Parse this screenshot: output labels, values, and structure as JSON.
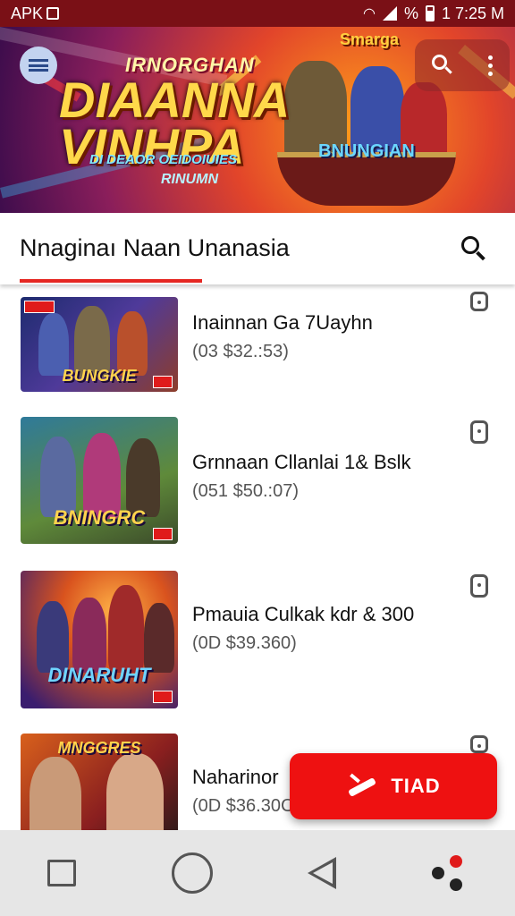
{
  "status_bar": {
    "app_label": "APK",
    "percent_label": "%",
    "time": "1 7:25 M"
  },
  "banner": {
    "top_logo": "Smarga",
    "subtitle": "IRNORGHAN",
    "title_line1": "DIAANNA",
    "title_line2": "VINHPA",
    "tagline": "DI DEAOR OEIDOIUIES",
    "small_text": "RINUMN",
    "right_title": "BNUNGIAN"
  },
  "section": {
    "title": "Nnaginaı Naan Unanasia"
  },
  "games": [
    {
      "thumb_label": "BUNGKIE",
      "title": "Inainnan Ga 7Uayhn",
      "price": "(03 $32.:53)"
    },
    {
      "thumb_label": "BNINGRC",
      "title": "Grnnaan Cllanlai 1& Bslk",
      "price": "(051 $50.:07)"
    },
    {
      "thumb_label": "DINARUHT",
      "title": "Pmauia Culkak kdr & 300",
      "price": "(0D $39.360)"
    },
    {
      "thumb_label": "MNGGRES",
      "title": "Naharinor",
      "price": "(0D $36.30C"
    }
  ],
  "fab": {
    "label": "TIAD"
  },
  "icons": {
    "menu": "menu-icon",
    "search": "search-icon",
    "overflow": "more-vert-icon",
    "download": "download-icon",
    "nav_recents": "recents-icon",
    "nav_home": "home-icon",
    "nav_back": "back-icon",
    "nav_extra": "dots-icon"
  },
  "colors": {
    "status_bar": "#7a1016",
    "accent": "#e52722",
    "fab": "#ee1111",
    "nav_bar": "#e6e6e6"
  }
}
